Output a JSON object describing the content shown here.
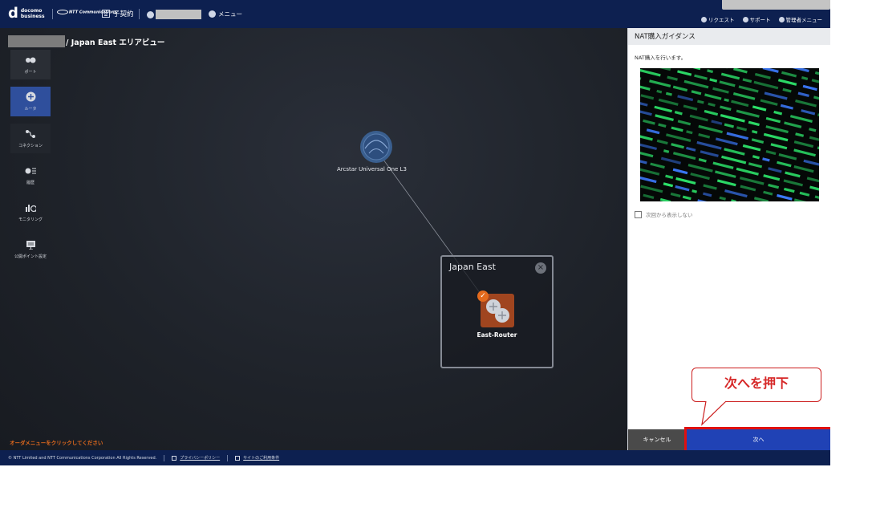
{
  "header": {
    "brand_line1": "docomo",
    "brand_line2": "business",
    "ntt_logo": "NTT Communications",
    "contract_label": "子契約",
    "menu_label": "メニュー",
    "request_label": "リクエスト",
    "support_label": "サポート",
    "admin_menu_label": "管理者メニュー"
  },
  "breadcrumb": {
    "current": "/ Japan East エリアビュー"
  },
  "sidebar": {
    "items": [
      {
        "label": "ポート",
        "icon": "port-icon"
      },
      {
        "label": "ルータ",
        "icon": "router-icon",
        "active": true
      },
      {
        "label": "コネクション",
        "icon": "connection-icon"
      },
      {
        "label": "履歴",
        "icon": "history-icon"
      },
      {
        "label": "モニタリング",
        "icon": "monitoring-icon"
      },
      {
        "label": "公開ポイント設定",
        "icon": "public-point-icon"
      }
    ]
  },
  "map": {
    "arcstar_label": "Arcstar Universal One L3",
    "area_title": "Japan East",
    "router_name": "East-Router",
    "order_hint": "オーダメニューをクリックしてください"
  },
  "panel": {
    "title": "NAT購入ガイダンス",
    "description": "NAT購入を行います。",
    "dont_show_label": "次回から表示しない",
    "cancel_label": "キャンセル",
    "next_label": "次へ"
  },
  "callout": {
    "text": "次へを押下"
  },
  "footer": {
    "copyright": "© NTT Limited and NTT Communications Corporation All Rights Reserved.",
    "privacy_label": "プライバシーポリシー",
    "terms_label": "サイトのご利用条件"
  },
  "colors": {
    "header_bg": "#0d2050",
    "accent_blue": "#2042b5",
    "router_orange": "#a0451f",
    "highlight_red": "#e01010",
    "terminal_green": "#2de36a"
  }
}
